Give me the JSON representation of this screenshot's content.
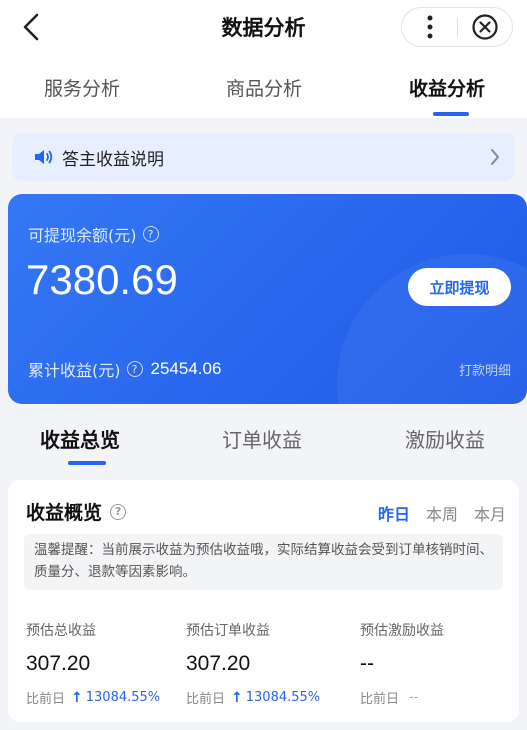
{
  "header": {
    "title": "数据分析"
  },
  "top_tabs": [
    {
      "label": "服务分析"
    },
    {
      "label": "商品分析"
    },
    {
      "label": "收益分析",
      "active": true
    }
  ],
  "notice": {
    "text": "答主收益说明"
  },
  "balance": {
    "label": "可提现余额(元)",
    "amount": "7380.69",
    "withdraw_label": "立即提现",
    "cumulative_label": "累计收益(元)",
    "cumulative_value": "25454.06",
    "payment_detail_label": "打款明细"
  },
  "sub_tabs": [
    {
      "label": "收益总览",
      "active": true
    },
    {
      "label": "订单收益"
    },
    {
      "label": "激励收益"
    }
  ],
  "overview": {
    "title": "收益概览",
    "periods": [
      {
        "label": "昨日",
        "active": true
      },
      {
        "label": "本周"
      },
      {
        "label": "本月"
      }
    ],
    "tip": "温馨提醒：当前展示收益为预估收益哦，实际结算收益会受到订单核销时间、质量分、退款等因素影响。",
    "metrics": [
      {
        "label": "预估总收益",
        "value": "307.20",
        "compare_label": "比前日",
        "change": "13084.55%"
      },
      {
        "label": "预估订单收益",
        "value": "307.20",
        "compare_label": "比前日",
        "change": "13084.55%"
      },
      {
        "label": "预估激励收益",
        "value": "--",
        "compare_label": "比前日",
        "change": "--"
      }
    ]
  },
  "colors": {
    "accent": "#2466f0",
    "card_gradient_start": "#3577f4",
    "card_gradient_end": "#1e5ae8"
  }
}
